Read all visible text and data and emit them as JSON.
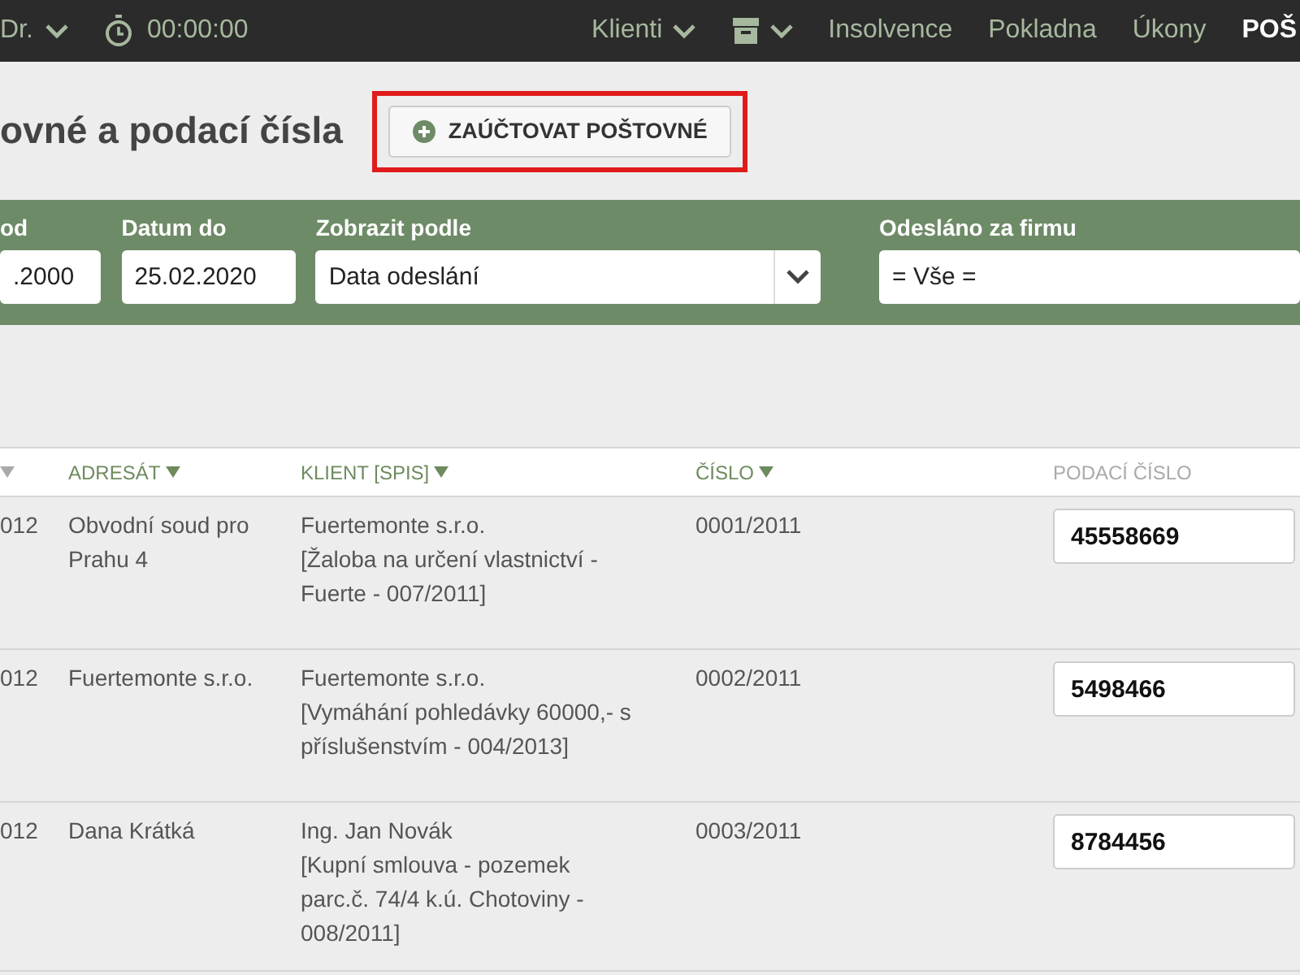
{
  "topbar": {
    "user": "Dr.",
    "timer": "00:00:00",
    "nav": [
      {
        "kind": "text",
        "label": "Klienti",
        "dropdown": true,
        "selected": false
      },
      {
        "kind": "icon",
        "dropdown": true,
        "selected": false
      },
      {
        "kind": "text",
        "label": "Insolvence",
        "dropdown": false,
        "selected": false
      },
      {
        "kind": "text",
        "label": "Pokladna",
        "dropdown": false,
        "selected": false
      },
      {
        "kind": "text",
        "label": "Úkony",
        "dropdown": false,
        "selected": false
      },
      {
        "kind": "text",
        "label": "POŠ",
        "dropdown": false,
        "selected": true
      }
    ]
  },
  "page": {
    "title": "ovné a podací čísla",
    "action": {
      "label": "ZAÚČTOVAT POŠTOVNÉ",
      "highlighted": true
    }
  },
  "filters": [
    {
      "kind": "text",
      "label": "od",
      "value": ".2000"
    },
    {
      "kind": "text",
      "label": "Datum do",
      "value": "25.02.2020"
    },
    {
      "kind": "select",
      "label": "Zobrazit podle",
      "value": "Data odeslání"
    },
    {
      "kind": "text",
      "label": "Odesláno za firmu",
      "value": "= Vše ="
    }
  ],
  "table": {
    "columns": [
      {
        "sortable": true
      },
      {
        "label": "ADRESÁT",
        "sortable": true
      },
      {
        "label": "KLIENT [SPIS]",
        "sortable": true
      },
      {
        "label": "ČÍSLO",
        "sortable": true
      },
      {
        "label": "PODACÍ ČÍSLO",
        "sortable": false
      }
    ],
    "rows": [
      {
        "column_1": "012",
        "adresat": "Obvodní soud pro Prahu 4",
        "klient": "Fuertemonte s.r.o.",
        "spis": "[Žaloba na určení vlastnictví - Fuerte - 007/2011]",
        "cislo": "0001/2011",
        "podaci_cislo": "45558669"
      },
      {
        "column_1": "012",
        "adresat": "Fuertemonte s.r.o.",
        "klient": "Fuertemonte s.r.o.",
        "spis": "[Vymáhání pohledávky 60000,- s příslušenstvím - 004/2013]",
        "cislo": "0002/2011",
        "podaci_cislo": "5498466"
      },
      {
        "column_1": "012",
        "adresat": "Dana Krátká",
        "klient": "Ing. Jan Novák",
        "spis": "[Kupní smlouva - pozemek parc.č. 74/4 k.ú. Chotoviny - 008/2011]",
        "cislo": "0003/2011",
        "podaci_cislo": "8784456"
      }
    ]
  }
}
